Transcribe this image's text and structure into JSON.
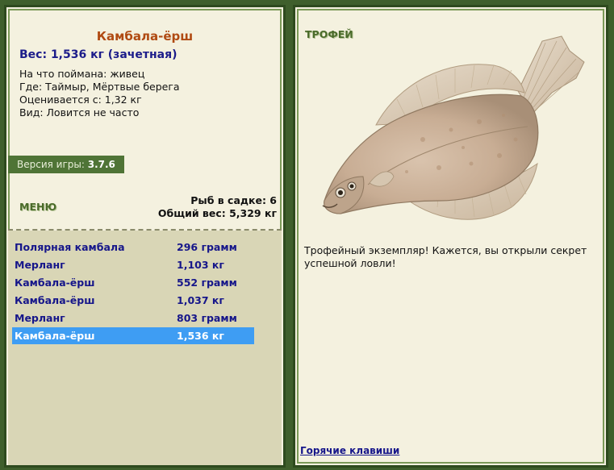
{
  "fish": {
    "name": "Камбала-ёрш",
    "weight_line": "Вес: 1,536 кг (зачетная)",
    "bait": "На что поймана: живец",
    "location": "Где: Таймыр, Мёртвые берега",
    "value": "Оценивается с: 1,32 кг",
    "species_note": "Вид: Ловится не часто"
  },
  "version": {
    "label": "Версия игры:",
    "number": "3.7.6"
  },
  "menu": {
    "label": "МЕНЮ"
  },
  "cage": {
    "count": "Рыб в садке: 6",
    "total": "Общий вес: 5,329 кг"
  },
  "catch_list": [
    {
      "name": "Полярная камбала",
      "weight": "296 грамм"
    },
    {
      "name": "Мерланг",
      "weight": "1,103 кг"
    },
    {
      "name": "Камбала-ёрш",
      "weight": "552 грамм"
    },
    {
      "name": "Камбала-ёрш",
      "weight": "1,037 кг"
    },
    {
      "name": "Мерланг",
      "weight": "803 грамм"
    },
    {
      "name": "Камбала-ёрш",
      "weight": "1,536 кг"
    }
  ],
  "trophy": {
    "title": "ТРОФЕЙ",
    "text": "Трофейный экземпляр! Кажется, вы открыли секрет успешной ловли!",
    "image_icon": "flounder-fish-icon"
  },
  "hotkeys_label": "Горячие клавиши",
  "colors": {
    "background": "#3f5f2c",
    "panel": "#f4f1df",
    "list_bg": "#d9d6b6",
    "selected": "#3e9df3",
    "fish_name": "#b04a12",
    "link": "#16168a"
  }
}
